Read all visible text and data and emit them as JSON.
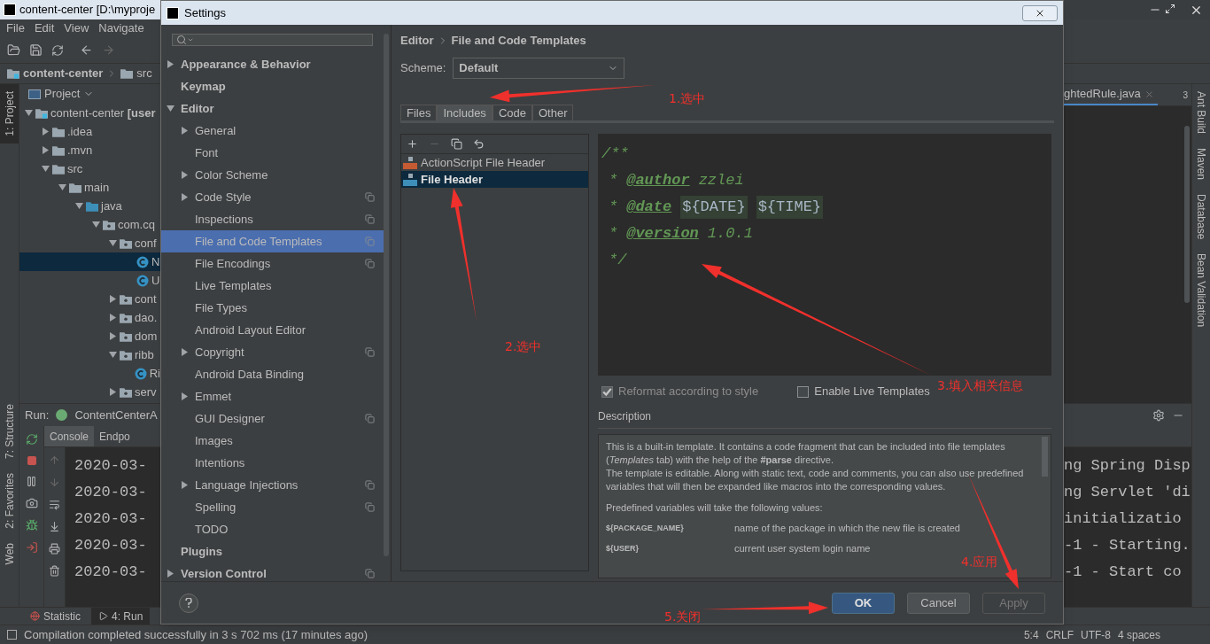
{
  "ide": {
    "title": "content-center [D:\\myproje",
    "menu": [
      "File",
      "Edit",
      "View",
      "Navigate"
    ],
    "breadcrumb": [
      "content-center",
      "src"
    ],
    "left_strip": [
      {
        "label": "1: Project",
        "selected": true
      },
      {
        "label": "7: Structure",
        "selected": false
      },
      {
        "label": "2: Favorites",
        "selected": false
      },
      {
        "label": "Web",
        "selected": false
      }
    ],
    "right_strip": [
      "Ant Build",
      "Maven",
      "Database",
      "Bean Validation"
    ],
    "project_panel": {
      "title": "Project",
      "tree": [
        {
          "label": "content-center **[user**",
          "kind": "module",
          "expanded": true,
          "selected": false,
          "children": [
            {
              "label": ".idea",
              "kind": "folder",
              "expanded": false,
              "selected": false
            },
            {
              "label": ".mvn",
              "kind": "folder",
              "expanded": false,
              "selected": false
            },
            {
              "label": "src",
              "kind": "folder",
              "expanded": true,
              "selected": false,
              "children": [
                {
                  "label": "main",
                  "kind": "folder",
                  "expanded": true,
                  "selected": false,
                  "children": [
                    {
                      "label": "java",
                      "kind": "source",
                      "expanded": true,
                      "selected": false,
                      "children": [
                        {
                          "label": "com.cq",
                          "kind": "package",
                          "expanded": true,
                          "selected": false,
                          "children": [
                            {
                              "label": "conf",
                              "kind": "package",
                              "expanded": true,
                              "selected": false,
                              "children": [
                                {
                                  "label": "N",
                                  "kind": "class",
                                  "selected": true
                                },
                                {
                                  "label": "U",
                                  "kind": "class",
                                  "selected": false
                                }
                              ]
                            },
                            {
                              "label": "cont",
                              "kind": "package",
                              "expanded": false,
                              "selected": false
                            },
                            {
                              "label": "dao.",
                              "kind": "package",
                              "expanded": false,
                              "selected": false
                            },
                            {
                              "label": "dom",
                              "kind": "package",
                              "expanded": false,
                              "selected": false
                            },
                            {
                              "label": "ribb",
                              "kind": "package",
                              "expanded": true,
                              "selected": false,
                              "children": [
                                {
                                  "label": "Ri",
                                  "kind": "class",
                                  "selected": false
                                }
                              ]
                            },
                            {
                              "label": "serv",
                              "kind": "package",
                              "expanded": false,
                              "selected": false
                            }
                          ]
                        }
                      ]
                    }
                  ]
                }
              ]
            }
          ]
        }
      ]
    },
    "run_panel": {
      "label": "Run:",
      "config": "ContentCenterA",
      "tabs": [
        {
          "label": "Console",
          "selected": true
        },
        {
          "label": "Endpo",
          "selected": false
        }
      ],
      "console_left": [
        "2020-03-",
        "2020-03-",
        "2020-03-",
        "2020-03-",
        "2020-03-"
      ],
      "console_right": [
        "ng Spring Disp",
        "ng Servlet 'di",
        "initializatio",
        "-1 - Starting.",
        "-1 - Start co"
      ]
    },
    "editor_tab": {
      "label": "ghtedRule.java",
      "count": "3"
    },
    "bottom_tabs": [
      {
        "label": "Statistic",
        "selected": false
      },
      {
        "label": "4: Run",
        "selected": true
      }
    ],
    "status_bar": {
      "message": "Compilation completed successfully in 3 s 702 ms (17 minutes ago)",
      "items": [
        "5:4",
        "CRLF",
        "UTF-8",
        "4 spaces"
      ]
    }
  },
  "dialog": {
    "title": "Settings",
    "tree": [
      {
        "label": "Appearance & Behavior",
        "expanded": false,
        "selected": false,
        "project_level": false
      },
      {
        "label": "Keymap",
        "selected": false,
        "project_level": false
      },
      {
        "label": "Editor",
        "expanded": true,
        "selected": false,
        "project_level": false,
        "children": [
          {
            "label": "General",
            "expanded": false,
            "selected": false,
            "project_level": false
          },
          {
            "label": "Font",
            "selected": false,
            "project_level": false
          },
          {
            "label": "Color Scheme",
            "expanded": false,
            "selected": false,
            "project_level": false
          },
          {
            "label": "Code Style",
            "expanded": false,
            "selected": false,
            "project_level": true
          },
          {
            "label": "Inspections",
            "selected": false,
            "project_level": true
          },
          {
            "label": "File and Code Templates",
            "selected": true,
            "project_level": true
          },
          {
            "label": "File Encodings",
            "selected": false,
            "project_level": true
          },
          {
            "label": "Live Templates",
            "selected": false,
            "project_level": false
          },
          {
            "label": "File Types",
            "selected": false,
            "project_level": false
          },
          {
            "label": "Android Layout Editor",
            "selected": false,
            "project_level": false
          },
          {
            "label": "Copyright",
            "expanded": false,
            "selected": false,
            "project_level": true
          },
          {
            "label": "Android Data Binding",
            "selected": false,
            "project_level": false
          },
          {
            "label": "Emmet",
            "expanded": false,
            "selected": false,
            "project_level": false
          },
          {
            "label": "GUI Designer",
            "selected": false,
            "project_level": true
          },
          {
            "label": "Images",
            "selected": false,
            "project_level": false
          },
          {
            "label": "Intentions",
            "selected": false,
            "project_level": false
          },
          {
            "label": "Language Injections",
            "expanded": false,
            "selected": false,
            "project_level": true
          },
          {
            "label": "Spelling",
            "selected": false,
            "project_level": true
          },
          {
            "label": "TODO",
            "selected": false,
            "project_level": false
          }
        ]
      },
      {
        "label": "Plugins",
        "selected": false,
        "project_level": false
      },
      {
        "label": "Version Control",
        "expanded": false,
        "selected": false,
        "project_level": true
      }
    ],
    "breadcrumb": [
      "Editor",
      "File and Code Templates"
    ],
    "scheme": {
      "label": "Scheme:",
      "value": "Default"
    },
    "tabs": [
      {
        "label": "Files",
        "selected": false
      },
      {
        "label": "Includes",
        "selected": true
      },
      {
        "label": "Code",
        "selected": false
      },
      {
        "label": "Other",
        "selected": false
      }
    ],
    "list_toolbar": [
      {
        "kind": "add",
        "disabled": false
      },
      {
        "kind": "remove",
        "disabled": true
      },
      {
        "kind": "copy",
        "disabled": false
      },
      {
        "kind": "reset",
        "disabled": false
      }
    ],
    "templates": [
      {
        "label": "ActionScript File Header",
        "kind": "actionscript",
        "selected": false
      },
      {
        "label": "File Header",
        "kind": "java",
        "selected": true
      }
    ],
    "editor_lines": [
      [
        {
          "kind": "comment",
          "text": "/**"
        }
      ],
      [
        {
          "kind": "comment",
          "text": "*"
        },
        {
          "kind": "tag",
          "text": "@author"
        },
        {
          "kind": "comment",
          "text": "zzlei"
        }
      ],
      [
        {
          "kind": "comment",
          "text": "*"
        },
        {
          "kind": "tag",
          "text": "@date"
        },
        {
          "kind": "variable",
          "text": "${DATE}"
        },
        {
          "kind": "variable",
          "text": "${TIME}"
        }
      ],
      [
        {
          "kind": "comment",
          "text": "*"
        },
        {
          "kind": "tag",
          "text": "@version"
        },
        {
          "kind": "comment",
          "text": "1.0.1"
        }
      ],
      [
        {
          "kind": "comment",
          "text": "*/"
        }
      ]
    ],
    "checkboxes": [
      {
        "label": "Reformat according to style",
        "checked": true,
        "disabled": true
      },
      {
        "label": "Enable Live Templates",
        "checked": false,
        "disabled": false
      }
    ],
    "description": {
      "title": "Description",
      "paragraphs": [
        "This is a built-in template. It contains a code fragment that can be included into file templates (*Templates* tab) with the help of the **#parse** directive.",
        "The template is editable. Along with static text, code and comments, you can also use predefined variables that will then be expanded like macros into the corresponding values."
      ],
      "intro": "Predefined variables will take the following values:",
      "variables": [
        {
          "name": "${PACKAGE_NAME}",
          "meaning": "name of the package in which the new file is created"
        },
        {
          "name": "${USER}",
          "meaning": "current user system login name"
        }
      ]
    },
    "buttons": [
      {
        "label": "OK",
        "default": true,
        "disabled": false
      },
      {
        "label": "Cancel",
        "default": false,
        "disabled": false
      },
      {
        "label": "Apply",
        "default": false,
        "disabled": true
      }
    ]
  },
  "annotations": [
    {
      "label": "1.选中"
    },
    {
      "label": "2.选中"
    },
    {
      "label": "3.填入相关信息"
    },
    {
      "label": "4.应用"
    },
    {
      "label": "5.关闭"
    }
  ]
}
